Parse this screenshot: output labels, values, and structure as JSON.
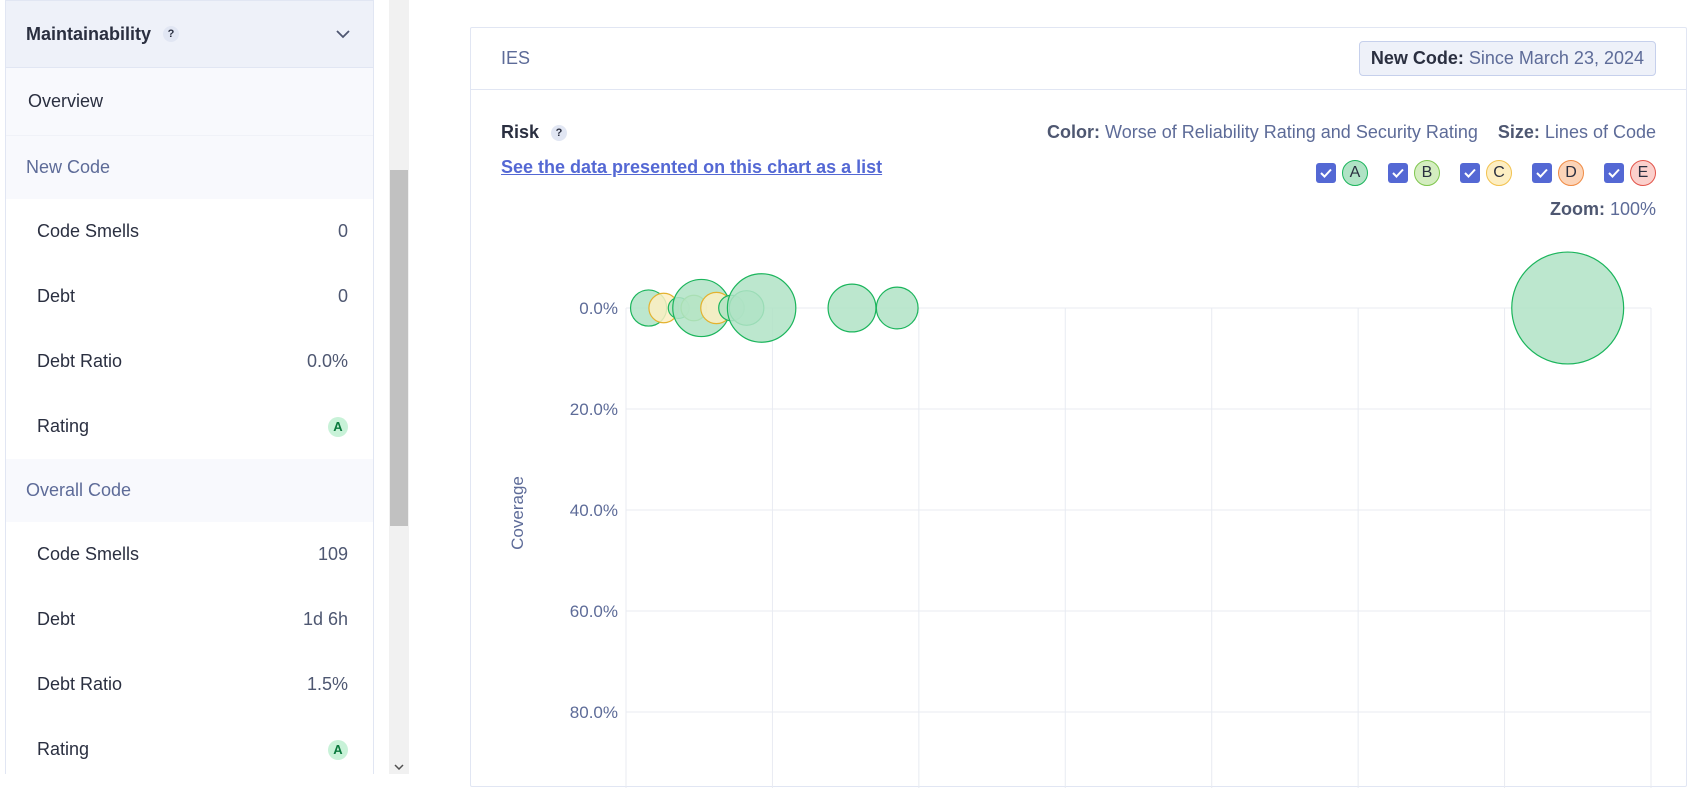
{
  "sidebar": {
    "title": "Maintainability",
    "help": "?",
    "overview": "Overview",
    "new_code": {
      "title": "New Code",
      "rows": [
        {
          "label": "Code Smells",
          "value": "0"
        },
        {
          "label": "Debt",
          "value": "0"
        },
        {
          "label": "Debt Ratio",
          "value": "0.0%"
        },
        {
          "label": "Rating",
          "value": "A"
        }
      ]
    },
    "overall_code": {
      "title": "Overall Code",
      "rows": [
        {
          "label": "Code Smells",
          "value": "109"
        },
        {
          "label": "Debt",
          "value": "1d 6h"
        },
        {
          "label": "Debt Ratio",
          "value": "1.5%"
        },
        {
          "label": "Rating",
          "value": "A"
        }
      ]
    }
  },
  "main": {
    "project": "IES",
    "new_code_label": "New Code:",
    "new_code_value": "Since March 23, 2024",
    "risk_label": "Risk",
    "risk_help": "?",
    "list_link": "See the data presented on this chart as a list",
    "color_label": "Color:",
    "color_value": "Worse of Reliability Rating and Security Rating",
    "size_label": "Size:",
    "size_value": "Lines of Code",
    "filters": [
      "A",
      "B",
      "C",
      "D",
      "E"
    ],
    "zoom_label": "Zoom:",
    "zoom_value": "100%"
  },
  "colors": {
    "accent": "#5468d4",
    "rating_a_fill": "#b0e3c5",
    "rating_a_stroke": "#1bb55c",
    "rating_b_fill": "#d4edc0",
    "rating_c_fill": "#fdeec2",
    "rating_d_fill": "#fcd4b8",
    "rating_e_fill": "#fbd0cc"
  },
  "chart_data": {
    "type": "scatter",
    "ylabel": "Coverage",
    "y_ticks": [
      "0.0%",
      "20.0%",
      "40.0%",
      "60.0%",
      "80.0%"
    ],
    "y_axis_inverted": true,
    "grid": true,
    "bubbles": [
      {
        "x": 0.03,
        "y": 0.0,
        "loc": 120,
        "rating": "A"
      },
      {
        "x": 0.05,
        "y": 0.0,
        "loc": 80,
        "rating": "C"
      },
      {
        "x": 0.07,
        "y": 0.0,
        "loc": 40,
        "rating": "A"
      },
      {
        "x": 0.09,
        "y": 0.0,
        "loc": 60,
        "rating": "B"
      },
      {
        "x": 0.1,
        "y": 0.0,
        "loc": 300,
        "rating": "A"
      },
      {
        "x": 0.12,
        "y": 0.0,
        "loc": 90,
        "rating": "C"
      },
      {
        "x": 0.14,
        "y": 0.0,
        "loc": 60,
        "rating": "A"
      },
      {
        "x": 0.16,
        "y": 0.0,
        "loc": 110,
        "rating": "A"
      },
      {
        "x": 0.18,
        "y": 0.0,
        "loc": 430,
        "rating": "A"
      },
      {
        "x": 0.3,
        "y": 0.0,
        "loc": 210,
        "rating": "A"
      },
      {
        "x": 0.36,
        "y": 0.0,
        "loc": 160,
        "rating": "A"
      },
      {
        "x": 1.25,
        "y": 0.0,
        "loc": 1150,
        "rating": "A"
      }
    ]
  }
}
